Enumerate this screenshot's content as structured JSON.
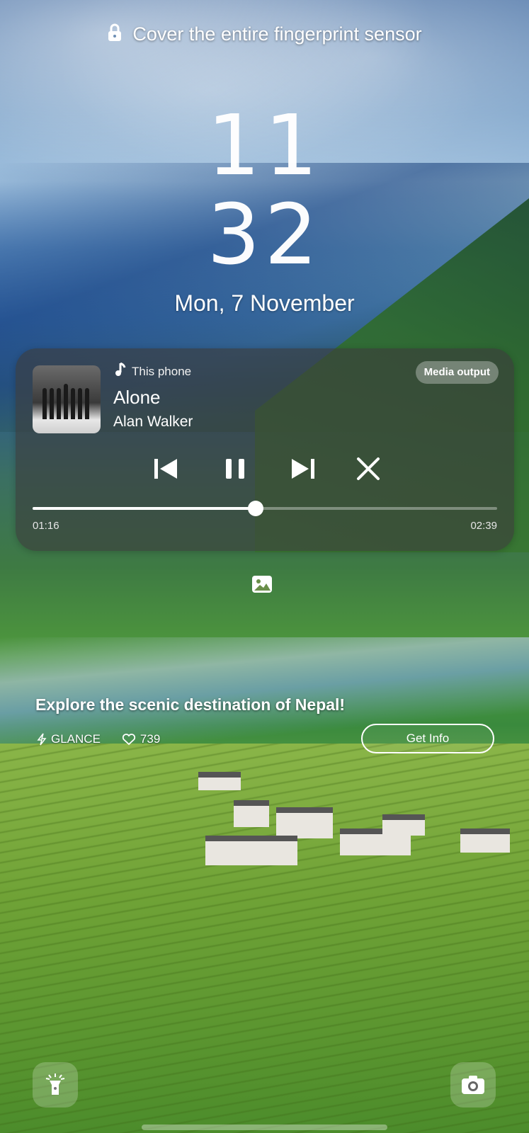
{
  "lock_screen": {
    "status_message": "Cover the entire fingerprint sensor",
    "clock_hours": "11",
    "clock_minutes": "32",
    "date": "Mon, 7 November"
  },
  "media": {
    "source": "This phone",
    "output_button": "Media output",
    "title": "Alone",
    "artist": "Alan Walker",
    "elapsed": "01:16",
    "duration": "02:39",
    "progress_fraction": 0.48,
    "controls": [
      "previous-icon",
      "pause-icon",
      "next-icon",
      "close-icon"
    ]
  },
  "glance": {
    "headline": "Explore the scenic destination of Nepal!",
    "brand": "GLANCE",
    "likes": "739",
    "cta": "Get Info"
  },
  "shortcuts": {
    "left": "flashlight-icon",
    "right": "camera-icon"
  }
}
